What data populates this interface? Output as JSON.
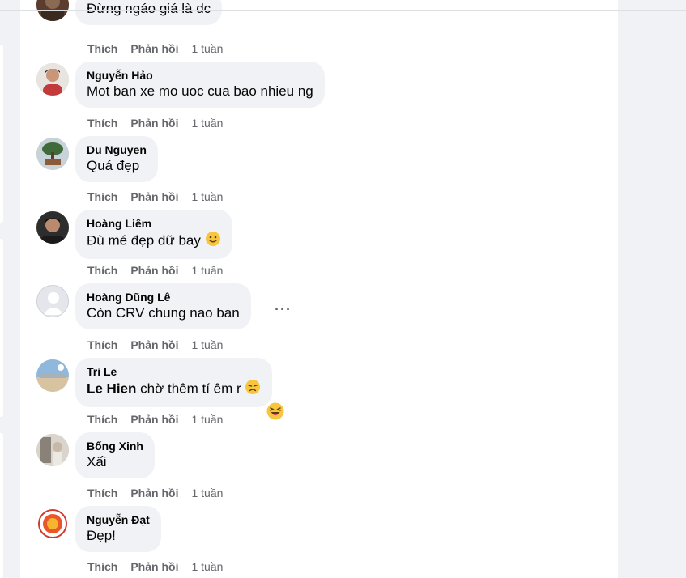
{
  "comments": [
    {
      "name": "",
      "text": "Đừng ngáo giá là dc",
      "like": "Thích",
      "reply": "Phản hồi",
      "time": "1 tuần"
    },
    {
      "name": "Nguyễn Hảo",
      "text": "Mot ban xe mo uoc cua bao nhieu ng",
      "like": "Thích",
      "reply": "Phản hồi",
      "time": "1 tuần"
    },
    {
      "name": "Du Nguyen",
      "text": "Quá đẹp",
      "like": "Thích",
      "reply": "Phản hồi",
      "time": "1 tuần"
    },
    {
      "name": "Hoàng Liêm",
      "text": "Đù mé đẹp dữ bay",
      "like": "Thích",
      "reply": "Phản hồi",
      "time": "1 tuần"
    },
    {
      "name": "Hoàng Dũng Lê",
      "text": "Còn CRV chung nao ban",
      "like": "Thích",
      "reply": "Phản hồi",
      "time": "1 tuần"
    },
    {
      "name": "Tri Le",
      "mention": "Le Hien",
      "text": "chờ thêm tí êm r",
      "like": "Thích",
      "reply": "Phản hồi",
      "time": "1 tuần"
    },
    {
      "name": "Bống Xinh",
      "text": "Xấi",
      "like": "Thích",
      "reply": "Phản hồi",
      "time": "1 tuần"
    },
    {
      "name": "Nguyễn Đạt",
      "text": "Đẹp!",
      "like": "Thích",
      "reply": "Phản hồi",
      "time": "1 tuần"
    }
  ],
  "more_options": "···",
  "colors": {
    "bubble": "#f0f2f5",
    "text": "#050505",
    "secondary": "#65676b",
    "page_bg": "#f0f2f5"
  }
}
